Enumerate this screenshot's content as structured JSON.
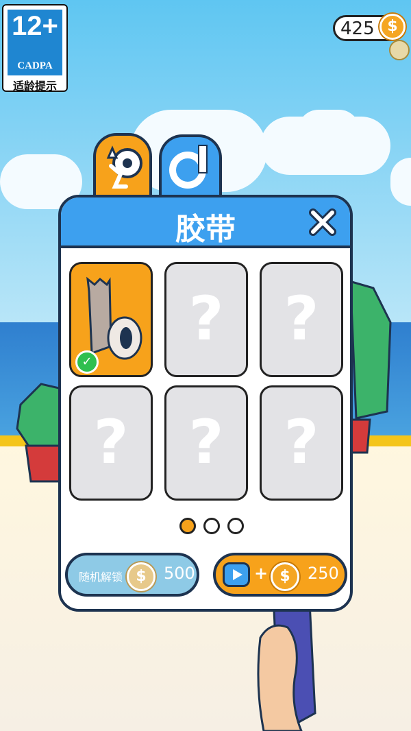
{
  "age_rating": {
    "number": "12+",
    "org": "CADPA",
    "hint": "适龄提示"
  },
  "coins": {
    "amount": "425",
    "icon": "dollar-coin-icon"
  },
  "tabs": [
    {
      "name": "tape-dispenser",
      "active": false
    },
    {
      "name": "tape-roll",
      "active": true
    }
  ],
  "panel": {
    "title": "胶带",
    "close_icon": "close-icon",
    "slots": [
      {
        "state": "selected",
        "item": "tape-roll"
      },
      {
        "state": "locked",
        "label": "?"
      },
      {
        "state": "locked",
        "label": "?"
      },
      {
        "state": "locked",
        "label": "?"
      },
      {
        "state": "locked",
        "label": "?"
      },
      {
        "state": "locked",
        "label": "?"
      }
    ],
    "page_indicator": {
      "pages": 3,
      "current": 1
    }
  },
  "buttons": {
    "random_unlock": {
      "label": "随机解锁",
      "price": "500"
    },
    "watch_ad": {
      "plus": "+",
      "price": "250"
    }
  },
  "colors": {
    "accent": "#f7a21b",
    "header": "#3da0ef",
    "outline": "#1d3350"
  }
}
